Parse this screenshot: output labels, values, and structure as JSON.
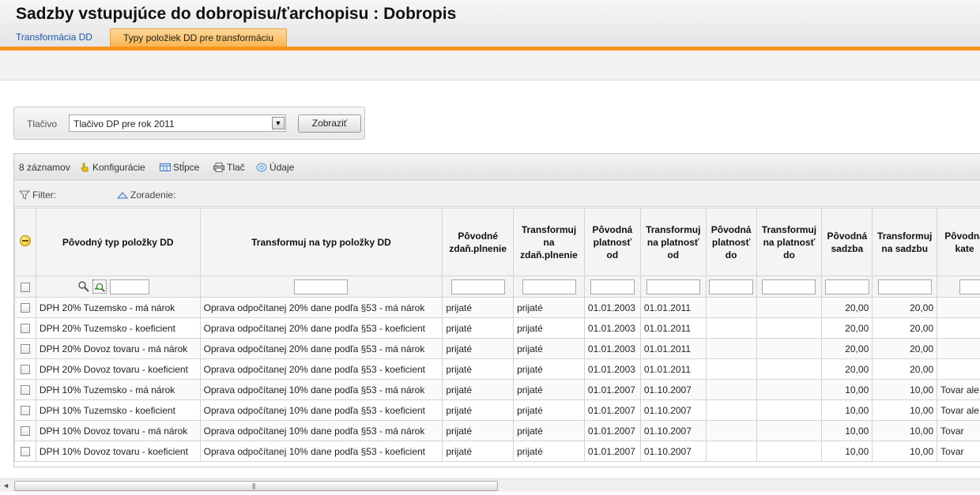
{
  "header": {
    "title": "Sadzby vstupujúce do dobropisu/ťarchopisu :  Dobropis",
    "tabs": [
      {
        "label": "Transformácia DD",
        "active": false
      },
      {
        "label": "Typy položiek DD pre transformáciu",
        "active": true
      }
    ]
  },
  "form": {
    "label": "Tlačivo",
    "select_value": "Tlačivo DP pre rok 2011",
    "button_label": "Zobraziť"
  },
  "toolbar": {
    "count_label": "8 záznamov",
    "config_label": "Konfigurácie",
    "columns_label": "Stĺpce",
    "print_label": "Tlač",
    "data_label": "Údaje"
  },
  "filterbar": {
    "filter_label": "Filter:",
    "sort_label": "Zoradenie:"
  },
  "table": {
    "headers": [
      "Pôvodný typ položky DD",
      "Transformuj na typ položky DD",
      "Pôvodné zdaň.plnenie",
      "Transformuj na zdaň.plnenie",
      "Pôvodná platnosť od",
      "Transformuj na platnosť od",
      "Pôvodná platnosť do",
      "Transformuj na platnosť do",
      "Pôvodná sadzba",
      "Transformuj na sadzbu",
      "Pôvodná kate"
    ],
    "rows": [
      [
        "DPH 20% Tuzemsko - má nárok",
        "Oprava odpočítanej 20% dane podľa §53 - má nárok",
        "prijaté",
        "prijaté",
        "01.01.2003",
        "01.01.2011",
        "",
        "",
        "20,00",
        "20,00",
        ""
      ],
      [
        "DPH 20% Tuzemsko - koeficient",
        "Oprava odpočítanej 20% dane podľa §53 - koeficient",
        "prijaté",
        "prijaté",
        "01.01.2003",
        "01.01.2011",
        "",
        "",
        "20,00",
        "20,00",
        ""
      ],
      [
        "DPH 20% Dovoz tovaru - má nárok",
        "Oprava odpočítanej 20% dane podľa §53 - má nárok",
        "prijaté",
        "prijaté",
        "01.01.2003",
        "01.01.2011",
        "",
        "",
        "20,00",
        "20,00",
        ""
      ],
      [
        "DPH 20% Dovoz tovaru - koeficient",
        "Oprava odpočítanej 20% dane podľa §53 - koeficient",
        "prijaté",
        "prijaté",
        "01.01.2003",
        "01.01.2011",
        "",
        "",
        "20,00",
        "20,00",
        ""
      ],
      [
        "DPH 10% Tuzemsko - má nárok",
        "Oprava odpočítanej 10% dane podľa §53 - má nárok",
        "prijaté",
        "prijaté",
        "01.01.2007",
        "01.10.2007",
        "",
        "",
        "10,00",
        "10,00",
        "Tovar ale"
      ],
      [
        "DPH 10% Tuzemsko - koeficient",
        "Oprava odpočítanej 10% dane podľa §53 - koeficient",
        "prijaté",
        "prijaté",
        "01.01.2007",
        "01.10.2007",
        "",
        "",
        "10,00",
        "10,00",
        "Tovar ale"
      ],
      [
        "DPH 10% Dovoz tovaru - má nárok",
        "Oprava odpočítanej 10% dane podľa §53 - má nárok",
        "prijaté",
        "prijaté",
        "01.01.2007",
        "01.10.2007",
        "",
        "",
        "10,00",
        "10,00",
        "Tovar"
      ],
      [
        "DPH 10% Dovoz tovaru - koeficient",
        "Oprava odpočítanej 10% dane podľa §53 - koeficient",
        "prijaté",
        "prijaté",
        "01.01.2007",
        "01.10.2007",
        "",
        "",
        "10,00",
        "10,00",
        "Tovar"
      ]
    ]
  },
  "colors": {
    "accent": "#f7941d",
    "tab_active": "#f9b44b",
    "link": "#1a55a6"
  }
}
